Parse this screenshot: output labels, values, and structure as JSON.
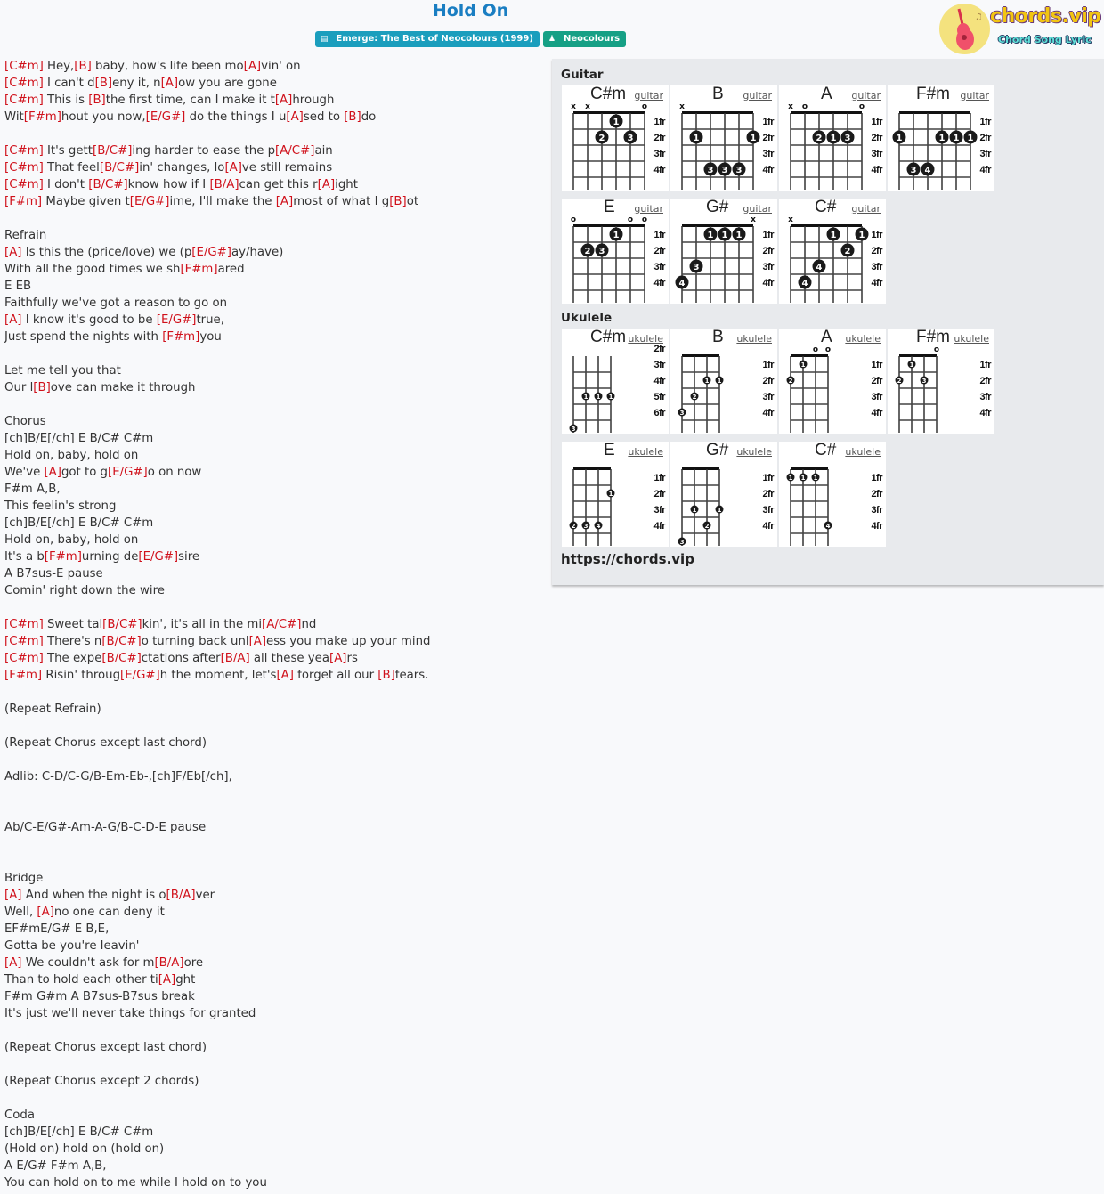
{
  "page": {
    "title": "Hold On",
    "album_badge": "Emerge: The Best of Neocolours (1999)",
    "artist_badge": "Neocolours",
    "album_icon": "book-icon",
    "artist_icon": "user-icon"
  },
  "logo": {
    "brand": "chords.vip",
    "tagline": "Chord Song Lyric",
    "icon": "guitar-icon"
  },
  "colors": {
    "title": "#1a7ec2",
    "chord": "#d0111b",
    "album_badge": "#1b9ebd",
    "artist_badge": "#16a085"
  },
  "lyrics": [
    [
      [
        "c",
        "[C#m]"
      ],
      [
        "t",
        " Hey,"
      ],
      [
        "c",
        "[B]"
      ],
      [
        "t",
        " baby, how's life been mo"
      ],
      [
        "c",
        "[A]"
      ],
      [
        "t",
        "vin' on"
      ]
    ],
    [
      [
        "c",
        "[C#m]"
      ],
      [
        "t",
        " I can't d"
      ],
      [
        "c",
        "[B]"
      ],
      [
        "t",
        "eny it, n"
      ],
      [
        "c",
        "[A]"
      ],
      [
        "t",
        "ow you are gone"
      ]
    ],
    [
      [
        "c",
        "[C#m]"
      ],
      [
        "t",
        " This is "
      ],
      [
        "c",
        "[B]"
      ],
      [
        "t",
        "the first time, can I make it t"
      ],
      [
        "c",
        "[A]"
      ],
      [
        "t",
        "hrough"
      ]
    ],
    [
      [
        "t",
        "Wit"
      ],
      [
        "c",
        "[F#m]"
      ],
      [
        "t",
        "hout you now,"
      ],
      [
        "c",
        "[E/G#]"
      ],
      [
        "t",
        " do the things I u"
      ],
      [
        "c",
        "[A]"
      ],
      [
        "t",
        "sed to "
      ],
      [
        "c",
        "[B]"
      ],
      [
        "t",
        "do"
      ]
    ],
    [],
    [
      [
        "c",
        "[C#m]"
      ],
      [
        "t",
        " It's gett"
      ],
      [
        "c",
        "[B/C#]"
      ],
      [
        "t",
        "ing harder to ease the p"
      ],
      [
        "c",
        "[A/C#]"
      ],
      [
        "t",
        "ain"
      ]
    ],
    [
      [
        "c",
        "[C#m]"
      ],
      [
        "t",
        " That feel"
      ],
      [
        "c",
        "[B/C#]"
      ],
      [
        "t",
        "in' changes, lo"
      ],
      [
        "c",
        "[A]"
      ],
      [
        "t",
        "ve still remains"
      ]
    ],
    [
      [
        "c",
        "[C#m]"
      ],
      [
        "t",
        " I don't "
      ],
      [
        "c",
        "[B/C#]"
      ],
      [
        "t",
        "know how if I "
      ],
      [
        "c",
        "[B/A]"
      ],
      [
        "t",
        "can get this r"
      ],
      [
        "c",
        "[A]"
      ],
      [
        "t",
        "ight"
      ]
    ],
    [
      [
        "c",
        "[F#m]"
      ],
      [
        "t",
        " Maybe given t"
      ],
      [
        "c",
        "[E/G#]"
      ],
      [
        "t",
        "ime, I'll make the "
      ],
      [
        "c",
        "[A]"
      ],
      [
        "t",
        "most of what I g"
      ],
      [
        "c",
        "[B]"
      ],
      [
        "t",
        "ot"
      ]
    ],
    [],
    [
      [
        "t",
        "Refrain"
      ]
    ],
    [
      [
        "c",
        "[A]"
      ],
      [
        "t",
        " Is this the (price/love) we (p"
      ],
      [
        "c",
        "[E/G#]"
      ],
      [
        "t",
        "ay/have)"
      ]
    ],
    [
      [
        "t",
        "With all the good times we sh"
      ],
      [
        "c",
        "[F#m]"
      ],
      [
        "t",
        "ared"
      ]
    ],
    [
      [
        "t",
        "E EB"
      ]
    ],
    [
      [
        "t",
        "Faithfully we've got a reason to go on"
      ]
    ],
    [
      [
        "c",
        "[A]"
      ],
      [
        "t",
        " I know it's good to be "
      ],
      [
        "c",
        "[E/G#]"
      ],
      [
        "t",
        "true,"
      ]
    ],
    [
      [
        "t",
        "Just spend the nights with "
      ],
      [
        "c",
        "[F#m]"
      ],
      [
        "t",
        "you"
      ]
    ],
    [],
    [
      [
        "t",
        "Let me tell you that"
      ]
    ],
    [
      [
        "t",
        "Our l"
      ],
      [
        "c",
        "[B]"
      ],
      [
        "t",
        "ove can make it through"
      ]
    ],
    [],
    [
      [
        "t",
        "Chorus"
      ]
    ],
    [
      [
        "t",
        "[ch]B/E[/ch] E B/C# C#m"
      ]
    ],
    [
      [
        "t",
        "Hold on, baby, hold on"
      ]
    ],
    [
      [
        "t",
        "We've "
      ],
      [
        "c",
        "[A]"
      ],
      [
        "t",
        "got to g"
      ],
      [
        "c",
        "[E/G#]"
      ],
      [
        "t",
        "o on now"
      ]
    ],
    [
      [
        "t",
        "F#m A,B,"
      ]
    ],
    [
      [
        "t",
        "This feelin's strong"
      ]
    ],
    [
      [
        "t",
        "[ch]B/E[/ch] E B/C# C#m"
      ]
    ],
    [
      [
        "t",
        "Hold on, baby, hold on"
      ]
    ],
    [
      [
        "t",
        "It's a b"
      ],
      [
        "c",
        "[F#m]"
      ],
      [
        "t",
        "urning de"
      ],
      [
        "c",
        "[E/G#]"
      ],
      [
        "t",
        "sire"
      ]
    ],
    [
      [
        "t",
        "A B7sus-E pause"
      ]
    ],
    [
      [
        "t",
        "Comin' right down the wire"
      ]
    ],
    [],
    [
      [
        "c",
        "[C#m]"
      ],
      [
        "t",
        " Sweet tal"
      ],
      [
        "c",
        "[B/C#]"
      ],
      [
        "t",
        "kin', it's all in the mi"
      ],
      [
        "c",
        "[A/C#]"
      ],
      [
        "t",
        "nd"
      ]
    ],
    [
      [
        "c",
        "[C#m]"
      ],
      [
        "t",
        " There's n"
      ],
      [
        "c",
        "[B/C#]"
      ],
      [
        "t",
        "o turning back unl"
      ],
      [
        "c",
        "[A]"
      ],
      [
        "t",
        "ess you make up your mind"
      ]
    ],
    [
      [
        "c",
        "[C#m]"
      ],
      [
        "t",
        " The expe"
      ],
      [
        "c",
        "[B/C#]"
      ],
      [
        "t",
        "ctations after"
      ],
      [
        "c",
        "[B/A]"
      ],
      [
        "t",
        " all these yea"
      ],
      [
        "c",
        "[A]"
      ],
      [
        "t",
        "rs"
      ]
    ],
    [
      [
        "c",
        "[F#m]"
      ],
      [
        "t",
        " Risin' throug"
      ],
      [
        "c",
        "[E/G#]"
      ],
      [
        "t",
        "h the moment, let's"
      ],
      [
        "c",
        "[A]"
      ],
      [
        "t",
        " forget all our "
      ],
      [
        "c",
        "[B]"
      ],
      [
        "t",
        "fears."
      ]
    ],
    [],
    [
      [
        "t",
        "(Repeat Refrain)"
      ]
    ],
    [],
    [
      [
        "t",
        "(Repeat Chorus except last chord)"
      ]
    ],
    [],
    [
      [
        "t",
        "Adlib: C-D/C-G/B-Em-Eb-,[ch]F/Eb[/ch],"
      ]
    ],
    [],
    [],
    [
      [
        "t",
        "Ab/C-E/G#-Am-A-G/B-C-D-E pause"
      ]
    ],
    [],
    [],
    [
      [
        "t",
        "Bridge"
      ]
    ],
    [
      [
        "c",
        "[A]"
      ],
      [
        "t",
        " And when the night is o"
      ],
      [
        "c",
        "[B/A]"
      ],
      [
        "t",
        "ver"
      ]
    ],
    [
      [
        "t",
        "Well, "
      ],
      [
        "c",
        "[A]"
      ],
      [
        "t",
        "no one can deny it"
      ]
    ],
    [
      [
        "t",
        "EF#mE/G# E B,E,"
      ]
    ],
    [
      [
        "t",
        "Gotta be you're leavin'"
      ]
    ],
    [
      [
        "c",
        "[A]"
      ],
      [
        "t",
        " We couldn't ask for m"
      ],
      [
        "c",
        "[B/A]"
      ],
      [
        "t",
        "ore"
      ]
    ],
    [
      [
        "t",
        "Than to hold each other ti"
      ],
      [
        "c",
        "[A]"
      ],
      [
        "t",
        "ght"
      ]
    ],
    [
      [
        "t",
        "F#m G#m A B7sus-B7sus break"
      ]
    ],
    [
      [
        "t",
        "It's just we'll never take things for granted"
      ]
    ],
    [],
    [
      [
        "t",
        "(Repeat Chorus except last chord)"
      ]
    ],
    [],
    [
      [
        "t",
        "(Repeat Chorus except 2 chords)"
      ]
    ],
    [],
    [
      [
        "t",
        "Coda"
      ]
    ],
    [
      [
        "t",
        "[ch]B/E[/ch] E B/C# C#m"
      ]
    ],
    [
      [
        "t",
        "(Hold on) hold on (hold on)"
      ]
    ],
    [
      [
        "t",
        "A E/G# F#m A,B,"
      ]
    ],
    [
      [
        "t",
        "You can hold on to me while I hold on to you"
      ]
    ]
  ],
  "panel": {
    "guitar_label": "Guitar",
    "ukulele_label": "Ukulele",
    "site_url": "https://chords.vip",
    "guitar": [
      {
        "name": "C#m",
        "link": "guitar",
        "top": [
          "x",
          "x",
          "",
          "",
          "",
          "o"
        ],
        "start": 1,
        "frets": [
          "1fr",
          "2fr",
          "3fr",
          "4fr"
        ],
        "dots": [
          [
            4,
            1,
            "1"
          ],
          [
            3,
            2,
            "2"
          ],
          [
            5,
            2,
            "3"
          ]
        ]
      },
      {
        "name": "B",
        "link": "guitar",
        "top": [
          "x",
          "",
          "",
          "",
          "",
          ""
        ],
        "start": 1,
        "frets": [
          "1fr",
          "2fr",
          "3fr",
          "4fr"
        ],
        "dots": [
          [
            2,
            2,
            "1"
          ],
          [
            6,
            2,
            "1"
          ],
          [
            3,
            4,
            "3"
          ],
          [
            4,
            4,
            "3"
          ],
          [
            5,
            4,
            "3"
          ]
        ]
      },
      {
        "name": "A",
        "link": "guitar",
        "top": [
          "x",
          "o",
          "",
          "",
          "",
          "o"
        ],
        "start": 1,
        "frets": [
          "1fr",
          "2fr",
          "3fr",
          "4fr"
        ],
        "dots": [
          [
            3,
            2,
            "2"
          ],
          [
            4,
            2,
            "1"
          ],
          [
            5,
            2,
            "3"
          ]
        ]
      },
      {
        "name": "F#m",
        "link": "guitar",
        "top": [
          "",
          "",
          "",
          "",
          "",
          ""
        ],
        "start": 1,
        "frets": [
          "1fr",
          "2fr",
          "3fr",
          "4fr"
        ],
        "dots": [
          [
            1,
            2,
            "1"
          ],
          [
            4,
            2,
            "1"
          ],
          [
            5,
            2,
            "1"
          ],
          [
            6,
            2,
            "1"
          ],
          [
            2,
            4,
            "3"
          ],
          [
            3,
            4,
            "4"
          ]
        ]
      },
      {
        "name": "E",
        "link": "guitar",
        "top": [
          "o",
          "",
          "",
          "",
          "o",
          "o"
        ],
        "start": 1,
        "frets": [
          "1fr",
          "2fr",
          "3fr",
          "4fr"
        ],
        "dots": [
          [
            4,
            1,
            "1"
          ],
          [
            2,
            2,
            "2"
          ],
          [
            3,
            2,
            "3"
          ]
        ]
      },
      {
        "name": "G#",
        "link": "guitar",
        "top": [
          "",
          "",
          "",
          "",
          "",
          "x"
        ],
        "start": 1,
        "frets": [
          "1fr",
          "2fr",
          "3fr",
          "4fr"
        ],
        "dots": [
          [
            3,
            1,
            "1"
          ],
          [
            4,
            1,
            "1"
          ],
          [
            5,
            1,
            "1"
          ],
          [
            2,
            3,
            "3"
          ],
          [
            1,
            4,
            "4"
          ]
        ]
      },
      {
        "name": "C#",
        "link": "guitar",
        "top": [
          "x",
          "",
          "",
          "",
          "",
          ""
        ],
        "start": 1,
        "frets": [
          "1fr",
          "2fr",
          "3fr",
          "4fr"
        ],
        "dots": [
          [
            4,
            1,
            "1"
          ],
          [
            6,
            1,
            "1"
          ],
          [
            5,
            2,
            "2"
          ],
          [
            3,
            3,
            "4"
          ],
          [
            2,
            4,
            "4"
          ]
        ]
      }
    ],
    "ukulele": [
      {
        "name": "C#m",
        "link": "ukulele",
        "top": [
          "",
          "",
          "",
          ""
        ],
        "nut": false,
        "frets": [
          "2fr",
          "3fr",
          "4fr",
          "5fr",
          "6fr"
        ],
        "dots": [
          [
            2,
            3,
            "1"
          ],
          [
            3,
            3,
            "1"
          ],
          [
            4,
            3,
            "1"
          ],
          [
            1,
            5,
            "3"
          ]
        ]
      },
      {
        "name": "B",
        "link": "ukulele",
        "top": [
          "",
          "",
          "",
          ""
        ],
        "nut": true,
        "frets": [
          "1fr",
          "2fr",
          "3fr",
          "4fr"
        ],
        "dots": [
          [
            3,
            2,
            "1"
          ],
          [
            4,
            2,
            "1"
          ],
          [
            2,
            3,
            "2"
          ],
          [
            1,
            4,
            "3"
          ]
        ]
      },
      {
        "name": "A",
        "link": "ukulele",
        "top": [
          "",
          "",
          "o",
          "o"
        ],
        "nut": true,
        "frets": [
          "1fr",
          "2fr",
          "3fr",
          "4fr"
        ],
        "dots": [
          [
            2,
            1,
            "1"
          ],
          [
            1,
            2,
            "2"
          ]
        ]
      },
      {
        "name": "F#m",
        "link": "ukulele",
        "top": [
          "",
          "",
          "",
          "o"
        ],
        "nut": true,
        "frets": [
          "1fr",
          "2fr",
          "3fr",
          "4fr"
        ],
        "dots": [
          [
            2,
            1,
            "1"
          ],
          [
            1,
            2,
            "2"
          ],
          [
            3,
            2,
            "3"
          ]
        ]
      },
      {
        "name": "E",
        "link": "ukulele",
        "top": [
          "",
          "",
          "",
          ""
        ],
        "nut": true,
        "frets": [
          "1fr",
          "2fr",
          "3fr",
          "4fr"
        ],
        "dots": [
          [
            4,
            2,
            "1"
          ],
          [
            1,
            4,
            "2"
          ],
          [
            2,
            4,
            "3"
          ],
          [
            3,
            4,
            "4"
          ]
        ]
      },
      {
        "name": "G#",
        "link": "ukulele",
        "top": [
          "",
          "",
          "",
          ""
        ],
        "nut": true,
        "frets": [
          "1fr",
          "2fr",
          "3fr",
          "4fr"
        ],
        "dots": [
          [
            2,
            3,
            "1"
          ],
          [
            4,
            3,
            "1"
          ],
          [
            3,
            4,
            "2"
          ],
          [
            1,
            5,
            "3"
          ]
        ]
      },
      {
        "name": "C#",
        "link": "ukulele",
        "top": [
          "",
          "",
          "",
          ""
        ],
        "nut": true,
        "frets": [
          "1fr",
          "2fr",
          "3fr",
          "4fr"
        ],
        "dots": [
          [
            1,
            1,
            "1"
          ],
          [
            2,
            1,
            "1"
          ],
          [
            3,
            1,
            "1"
          ],
          [
            4,
            4,
            "4"
          ]
        ]
      }
    ]
  }
}
